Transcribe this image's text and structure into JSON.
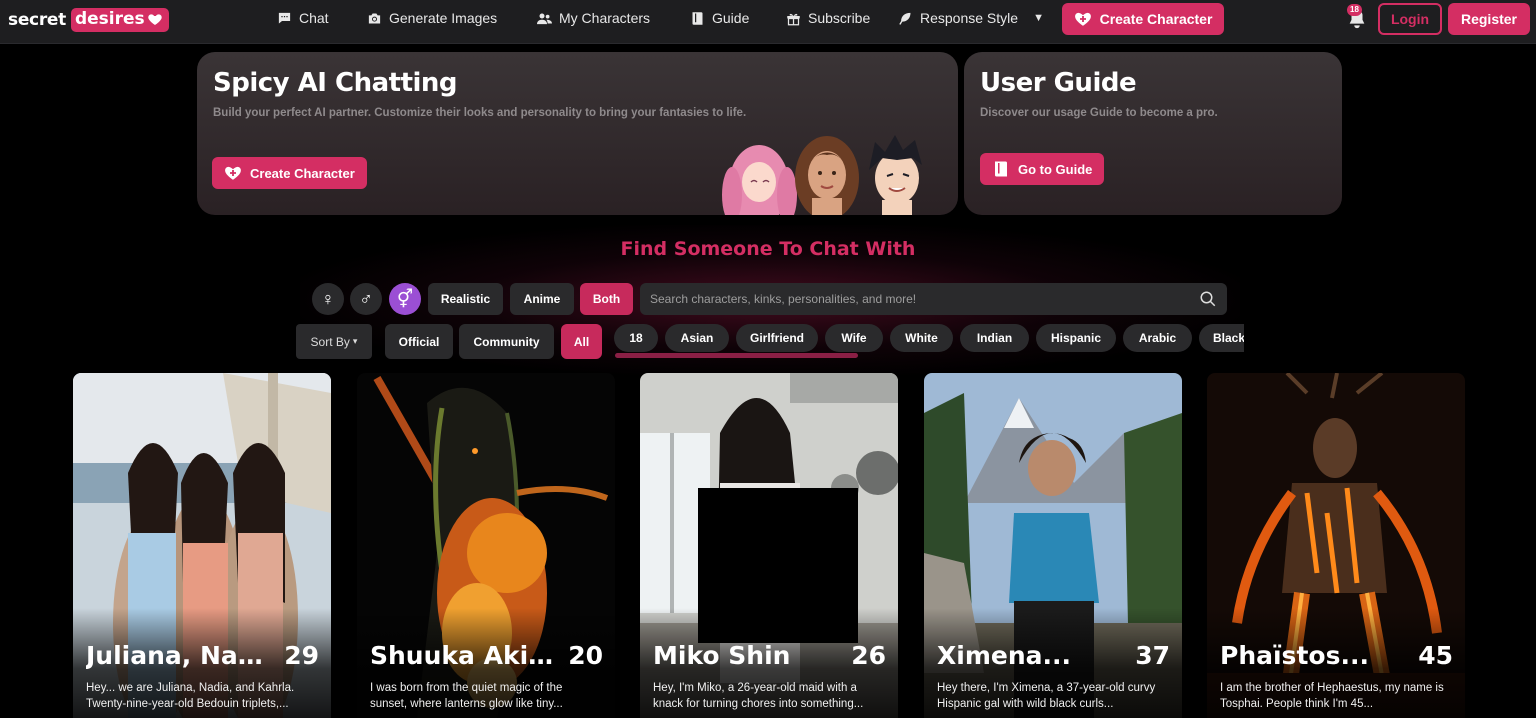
{
  "brand": {
    "word1": "secret",
    "word2": "desires"
  },
  "nav": {
    "items": [
      {
        "label": "Chat",
        "icon": "chat-icon"
      },
      {
        "label": "Generate Images",
        "icon": "camera-icon"
      },
      {
        "label": "My Characters",
        "icon": "users-icon"
      },
      {
        "label": "Guide",
        "icon": "book-icon"
      },
      {
        "label": "Subscribe",
        "icon": "gift-icon"
      },
      {
        "label": "Response Style",
        "icon": "feather-icon"
      }
    ],
    "create_label": "Create Character",
    "badge_18": "18",
    "login_label": "Login",
    "register_label": "Register"
  },
  "hero": {
    "left": {
      "title": "Spicy AI Chatting",
      "subtitle": "Build your perfect AI partner. Customize their looks and personality to bring your fantasies to life.",
      "button": "Create Character"
    },
    "right": {
      "title": "User Guide",
      "subtitle": "Discover our usage Guide to become a pro.",
      "button": "Go to Guide"
    }
  },
  "find": {
    "title": "Find Someone To Chat With",
    "gender": {
      "female": "♀",
      "male": "♂",
      "both": "⚥"
    },
    "styles": [
      "Realistic",
      "Anime",
      "Both"
    ],
    "style_selected": "Both",
    "search_placeholder": "Search characters, kinks, personalities, and more!",
    "sort_label": "Sort By",
    "sources": [
      "Official",
      "Community",
      "All"
    ],
    "source_selected": "All",
    "tags": [
      "18",
      "Asian",
      "Girlfriend",
      "Wife",
      "White",
      "Indian",
      "Hispanic",
      "Arabic",
      "Black"
    ]
  },
  "cards": [
    {
      "name": "Juliana, Nadi...",
      "age": "29",
      "desc": "Hey... we are Juliana, Nadia, and Kahrla. Twenty-nine-year-old Bedouin triplets,..."
    },
    {
      "name": "Shuuka Akika",
      "age": "20",
      "desc": "I was born from the quiet magic of the sunset, where lanterns glow like tiny..."
    },
    {
      "name": "Miko Shin",
      "age": "26",
      "desc": "Hey, I'm Miko, a 26-year-old maid with a knack for turning chores into something..."
    },
    {
      "name": "Ximena...",
      "age": "37",
      "desc": "Hey there, I'm Ximena, a 37-year-old curvy Hispanic gal with wild black curls..."
    },
    {
      "name": "Phaïstos...",
      "age": "45",
      "desc": "I am the brother of Hephaestus, my name is Tosphai. People think I'm 45..."
    }
  ]
}
